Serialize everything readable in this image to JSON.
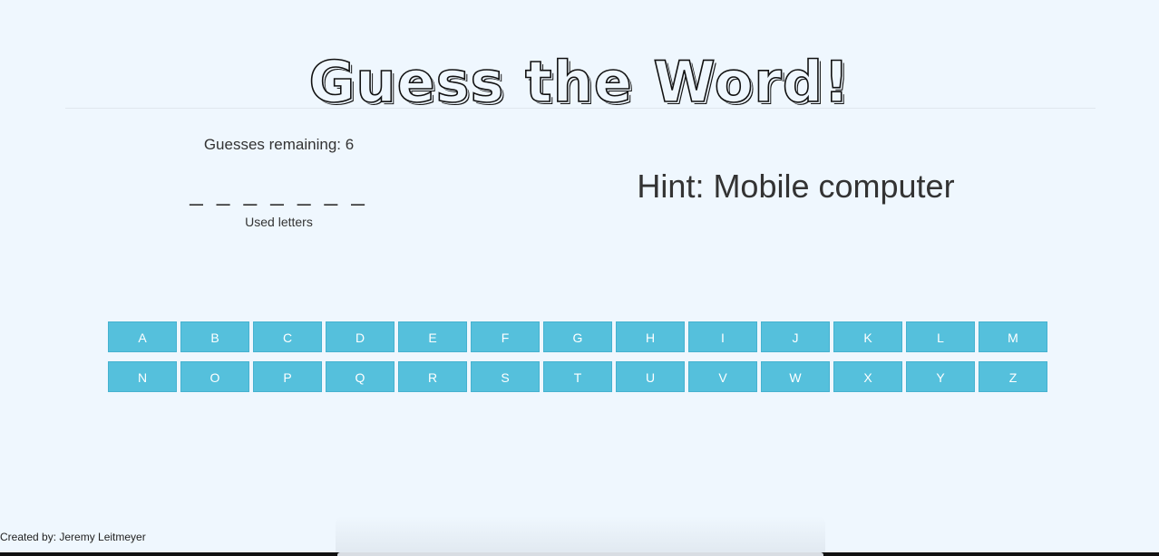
{
  "title": "Guess the Word!",
  "game": {
    "guesses_remaining": "Guesses remaining: 6",
    "word_display": "_ _ _ _ _ _ _",
    "used_letters_label": "Used letters",
    "hint": "Hint: Mobile computer"
  },
  "keyboard": {
    "row1": [
      "A",
      "B",
      "C",
      "D",
      "E",
      "F",
      "G",
      "H",
      "I",
      "J",
      "K",
      "L",
      "M"
    ],
    "row2": [
      "N",
      "O",
      "P",
      "Q",
      "R",
      "S",
      "T",
      "U",
      "V",
      "W",
      "X",
      "Y",
      "Z"
    ]
  },
  "footer": {
    "credit": "Created by: Jeremy Leitmeyer"
  },
  "colors": {
    "background": "#eff7fe",
    "key": "#55c0dc",
    "text": "#333333"
  }
}
